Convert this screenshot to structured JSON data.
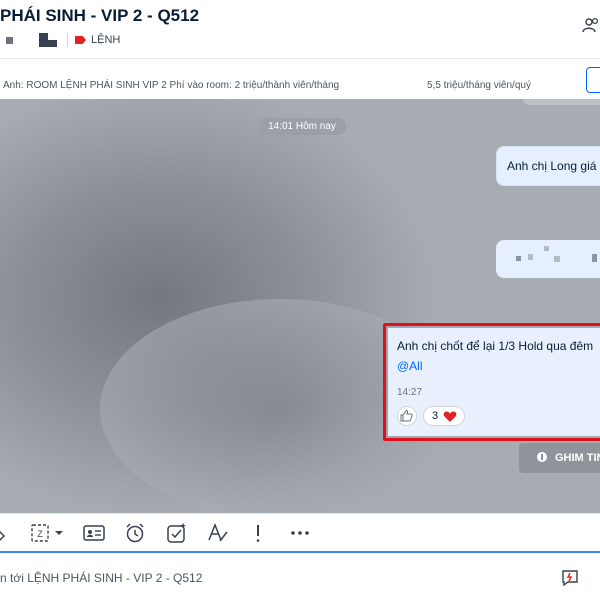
{
  "header": {
    "title": "PHÁI SINH - VIP 2 - Q512",
    "tag_label": "LỆNH",
    "tag_color": "#e02424"
  },
  "pinned": {
    "text_left": "Anh: ROOM LỆNH PHÁI SINH VIP 2 Phí vào room: 2 triệu/thành viên/tháng",
    "text_right": "5,5 triệu/tháng viên/quý"
  },
  "chat": {
    "time_divider": "14:01 Hôm nay",
    "message_1": "Anh chị Long giá",
    "highlighted": {
      "text": "Anh chị chốt để lại 1/3 Hold qua đêm",
      "mention": "@All",
      "time": "14:27",
      "reaction_count": "3",
      "reaction_icon": "heart-icon",
      "highlight_color": "#e10e1e"
    },
    "pin_button_label": "GHIM TIN"
  },
  "toolbar": {
    "icons": [
      "sticker-icon",
      "screenshot-icon",
      "contact-card-icon",
      "alarm-clock-icon",
      "checklist-icon",
      "text-format-icon",
      "exclamation-icon",
      "more-icon"
    ]
  },
  "input": {
    "placeholder": "n tới LỆNH PHÁI SINH - VIP 2 - Q512"
  },
  "colors": {
    "accent": "#0068ff",
    "bubble": "#e5efff"
  }
}
